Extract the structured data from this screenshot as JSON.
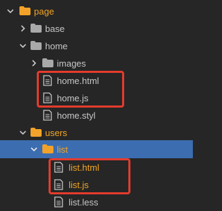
{
  "tree": {
    "items": [
      {
        "label": "page"
      },
      {
        "label": "base"
      },
      {
        "label": "home"
      },
      {
        "label": "images"
      },
      {
        "label": "home.html"
      },
      {
        "label": "home.js"
      },
      {
        "label": "home.styl"
      },
      {
        "label": "users"
      },
      {
        "label": "list"
      },
      {
        "label": "list.html"
      },
      {
        "label": "list.js"
      },
      {
        "label": "list.less"
      }
    ]
  },
  "colors": {
    "background": "#262626",
    "selection": "#3c6db0",
    "folder_orange": "#f2a22a",
    "folder_gray": "#a9a9a9",
    "highlight_red": "#e53b2c",
    "label_orange": "#f5a623",
    "label_gray": "#c7c7c7"
  }
}
